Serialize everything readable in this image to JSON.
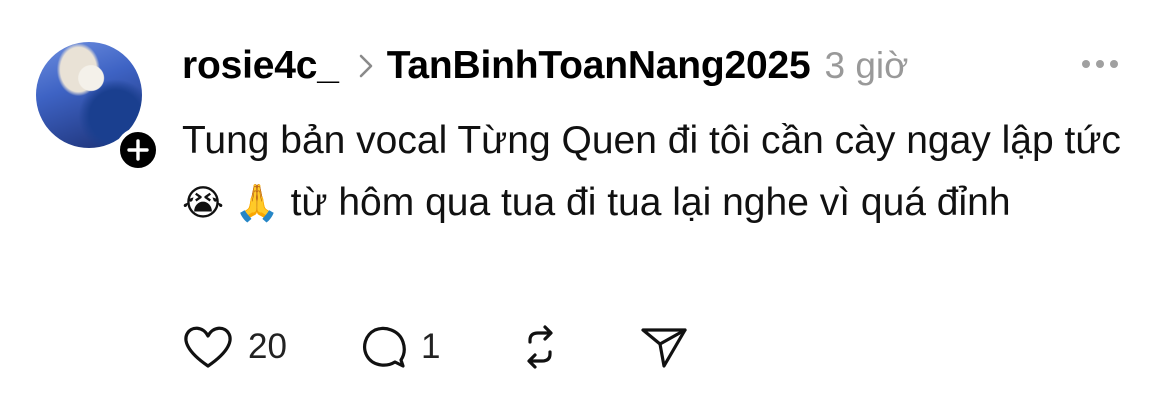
{
  "post": {
    "username": "rosie4c_",
    "thread_name": "TanBinhToanNang2025",
    "time": "3 giờ",
    "text_part1": "Tung bản vocal Từng Quen đi tôi cần cày ngay lập tức",
    "emoji_1": "😭",
    "emoji_2": "🙏",
    "text_part2": " từ hôm qua tua đi tua lại  nghe vì quá đỉnh"
  },
  "actions": {
    "like_count": "20",
    "reply_count": "1"
  },
  "icons": {
    "avatar": "profile-photo",
    "follow": "plus-icon",
    "separator": "chevron-right-icon",
    "more": "more-horizontal-icon",
    "like": "heart-icon",
    "reply": "comment-bubble-icon",
    "repost": "repost-icon",
    "share": "send-icon"
  },
  "colors": {
    "background": "#ffffff",
    "text": "#000000",
    "muted": "#999999"
  }
}
